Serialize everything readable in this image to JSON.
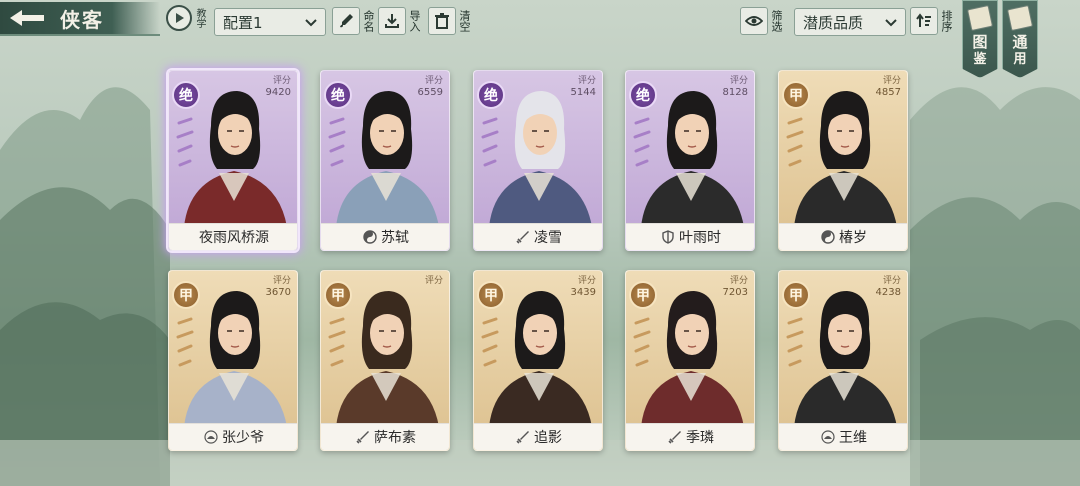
{
  "header": {
    "title": "侠客",
    "tutorial_label": "教学",
    "config_value": "配置1",
    "rename_label": "命名",
    "import_label": "导入",
    "clear_label": "清空",
    "filter_label": "筛选",
    "quality_value": "潜质品质",
    "sort_label": "排序",
    "gallery_tab_a": "图",
    "gallery_tab_b": "鉴",
    "general_tab_a": "通",
    "general_tab_b": "用"
  },
  "colors": {
    "purple_card": "#bea5d4",
    "gold_card": "#dcc08e",
    "header_green": "#3f5f53"
  },
  "cards": [
    {
      "name": "夜雨风桥源",
      "rarity": "绝",
      "score_label": "评分",
      "score": "9420",
      "tier": "purple",
      "sect_icon": "none",
      "selected": true
    },
    {
      "name": "苏轼",
      "rarity": "绝",
      "score_label": "评分",
      "score": "6559",
      "tier": "purple",
      "sect_icon": "yin-yang-icon",
      "selected": false
    },
    {
      "name": "凌雪",
      "rarity": "绝",
      "score_label": "评分",
      "score": "5144",
      "tier": "purple",
      "sect_icon": "sword-icon",
      "selected": false
    },
    {
      "name": "叶雨时",
      "rarity": "绝",
      "score_label": "评分",
      "score": "8128",
      "tier": "purple",
      "sect_icon": "shield-icon",
      "selected": false
    },
    {
      "name": "椿岁",
      "rarity": "甲",
      "score_label": "评分",
      "score": "4857",
      "tier": "gold",
      "sect_icon": "yin-yang-icon",
      "selected": false
    },
    {
      "name": "张少爷",
      "rarity": "甲",
      "score_label": "评分",
      "score": "3670",
      "tier": "gold",
      "sect_icon": "lotus-icon",
      "selected": false
    },
    {
      "name": "萨布素",
      "rarity": "甲",
      "score_label": "评分",
      "score": "",
      "tier": "gold",
      "sect_icon": "sword-icon",
      "selected": false
    },
    {
      "name": "追影",
      "rarity": "甲",
      "score_label": "评分",
      "score": "3439",
      "tier": "gold",
      "sect_icon": "sword-icon",
      "selected": false
    },
    {
      "name": "季璘",
      "rarity": "甲",
      "score_label": "评分",
      "score": "7203",
      "tier": "gold",
      "sect_icon": "sword-icon",
      "selected": false
    },
    {
      "name": "王维",
      "rarity": "甲",
      "score_label": "评分",
      "score": "4238",
      "tier": "gold",
      "sect_icon": "lotus-icon",
      "selected": false
    }
  ]
}
